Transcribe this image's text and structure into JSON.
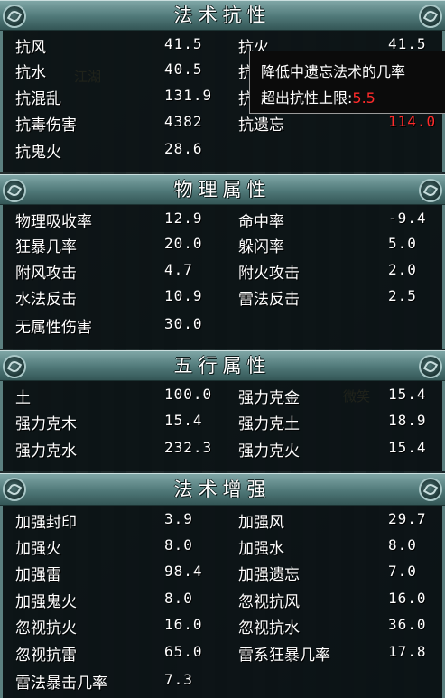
{
  "colors": {
    "text": "#ffffff",
    "highlight": "#ff2b2b",
    "header": "#4f7878"
  },
  "sections": [
    {
      "title": "法术抗性",
      "rows": [
        [
          {
            "label": "抗风",
            "value": "41.5"
          },
          {
            "label": "抗火",
            "value": "41.5"
          }
        ],
        [
          {
            "label": "抗水",
            "value": "40.5"
          },
          {
            "label": "抗",
            "value": ""
          }
        ],
        [
          {
            "label": "抗混乱",
            "value": "131.9"
          },
          {
            "label": "抗",
            "value": ""
          }
        ],
        [
          {
            "label": "抗毒伤害",
            "value": "4382"
          },
          {
            "label": "抗遗忘",
            "value": "114.0"
          }
        ],
        [
          {
            "label": "抗鬼火",
            "value": "28.6"
          }
        ]
      ]
    },
    {
      "title": "物理属性",
      "rows": [
        [
          {
            "label": "物理吸收率",
            "value": "12.9"
          },
          {
            "label": "命中率",
            "value": "-9.4"
          }
        ],
        [
          {
            "label": "狂暴几率",
            "value": "20.0"
          },
          {
            "label": "躲闪率",
            "value": "5.0"
          }
        ],
        [
          {
            "label": "附风攻击",
            "value": "4.7"
          },
          {
            "label": "附火攻击",
            "value": "2.0"
          }
        ],
        [
          {
            "label": "水法反击",
            "value": "10.9"
          },
          {
            "label": "雷法反击",
            "value": "2.5"
          }
        ],
        [
          {
            "label": "无属性伤害",
            "value": "30.0"
          }
        ]
      ]
    },
    {
      "title": "五行属性",
      "rows": [
        [
          {
            "label": "土",
            "value": "100.0"
          },
          {
            "label": "强力克金",
            "value": "15.4"
          }
        ],
        [
          {
            "label": "强力克木",
            "value": "15.4"
          },
          {
            "label": "强力克土",
            "value": "18.9"
          }
        ],
        [
          {
            "label": "强力克水",
            "value": "232.3"
          },
          {
            "label": "强力克火",
            "value": "15.4"
          }
        ]
      ]
    },
    {
      "title": "法术增强",
      "rows": [
        [
          {
            "label": "加强封印",
            "value": "3.9"
          },
          {
            "label": "加强风",
            "value": "29.7"
          }
        ],
        [
          {
            "label": "加强火",
            "value": "8.0"
          },
          {
            "label": "加强水",
            "value": "8.0"
          }
        ],
        [
          {
            "label": "加强雷",
            "value": "98.4"
          },
          {
            "label": "加强遗忘",
            "value": "7.0"
          }
        ],
        [
          {
            "label": "加强鬼火",
            "value": "8.0"
          },
          {
            "label": "忽视抗风",
            "value": "16.0"
          }
        ],
        [
          {
            "label": "忽视抗火",
            "value": "16.0"
          },
          {
            "label": "忽视抗水",
            "value": "36.0"
          }
        ],
        [
          {
            "label": "忽视抗雷",
            "value": "65.0"
          },
          {
            "label": "雷系狂暴几率",
            "value": "17.8"
          }
        ],
        [
          {
            "label": "雷法暴击几率",
            "value": "7.3"
          }
        ]
      ]
    }
  ],
  "tooltip": {
    "line1": "降低中遗忘法术的几率",
    "line2_prefix": "超出抗性上限:",
    "line2_value": "5.5"
  },
  "background": {
    "text1": "江湖",
    "text2": "微笑"
  }
}
